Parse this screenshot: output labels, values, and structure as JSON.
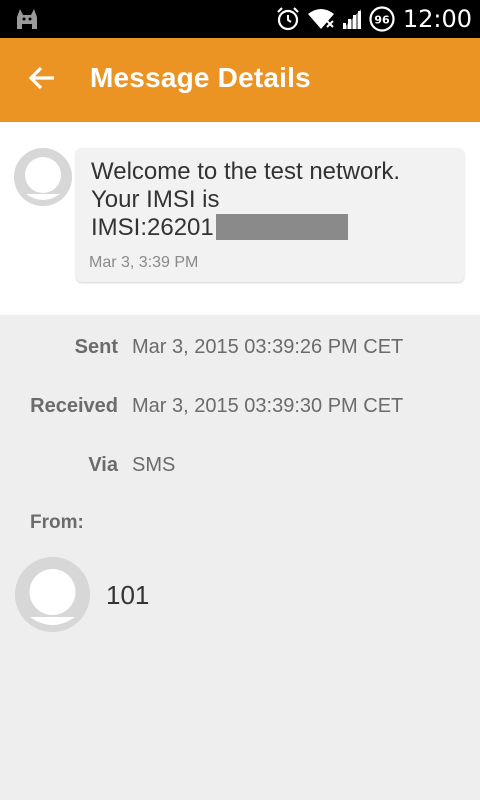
{
  "status_bar": {
    "time": "12:00",
    "battery_level": "96",
    "icons": [
      "cat-notification-icon",
      "alarm-icon",
      "wifi-icon",
      "signal-icon",
      "battery-icon"
    ]
  },
  "app_bar": {
    "title": "Message Details",
    "background_color": "#ec9423",
    "back_icon": "arrow-left-icon"
  },
  "message": {
    "line1": "Welcome to the test network.",
    "line2": "Your IMSI is",
    "line3_prefix": "IMSI:26201",
    "timestamp": "Mar 3, 3:39 PM"
  },
  "details": {
    "sent_label": "Sent",
    "sent_value": "Mar 3, 2015 03:39:26 PM CET",
    "received_label": "Received",
    "received_value": "Mar 3, 2015 03:39:30 PM CET",
    "via_label": "Via",
    "via_value": "SMS",
    "from_label": "From:"
  },
  "contact": {
    "number": "101"
  }
}
